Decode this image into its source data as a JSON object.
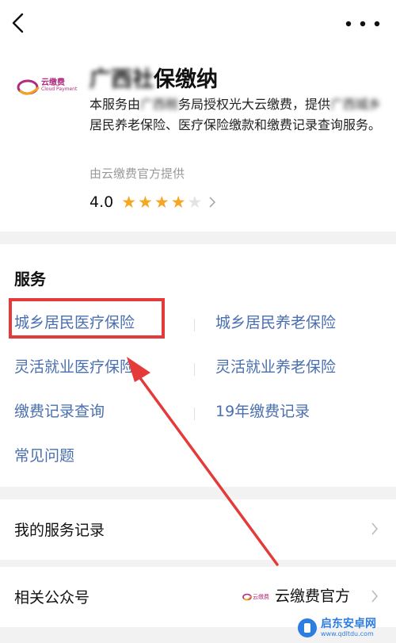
{
  "header": {
    "logo_text": "云缴费",
    "logo_subtext": "Cloud Payment",
    "title_prefix": "广西",
    "title_mid": "社",
    "title_suffix": "保缴纳",
    "desc_part1": "本服务由",
    "desc_blur1": "广西税",
    "desc_part2": "务局授权光大云缴费，提供",
    "desc_blur2": "广西城乡",
    "desc_part3": "居民养老保险、医疗保险缴款和缴费记录查询服务。",
    "provider": "由云缴费官方提供",
    "rating_value": "4.0",
    "rating_stars": 4,
    "rating_max": 5
  },
  "services": {
    "title": "服务",
    "items": [
      "城乡居民医疗保险",
      "城乡居民养老保险",
      "灵活就业医疗保险",
      "灵活就业养老保险",
      "缴费记录查询",
      "19年缴费记录",
      "常见问题"
    ]
  },
  "my_records": {
    "label": "我的服务记录"
  },
  "official_account": {
    "label": "相关公众号",
    "name": "云缴费官方",
    "logo_text": "云缴费"
  },
  "watermark": {
    "title": "启东安卓网",
    "url": "www.qdltdu.com"
  },
  "colors": {
    "link": "#4a6fb0",
    "star": "#f5a623",
    "highlight": "#e43a3a",
    "brand": "#b02a7d"
  }
}
